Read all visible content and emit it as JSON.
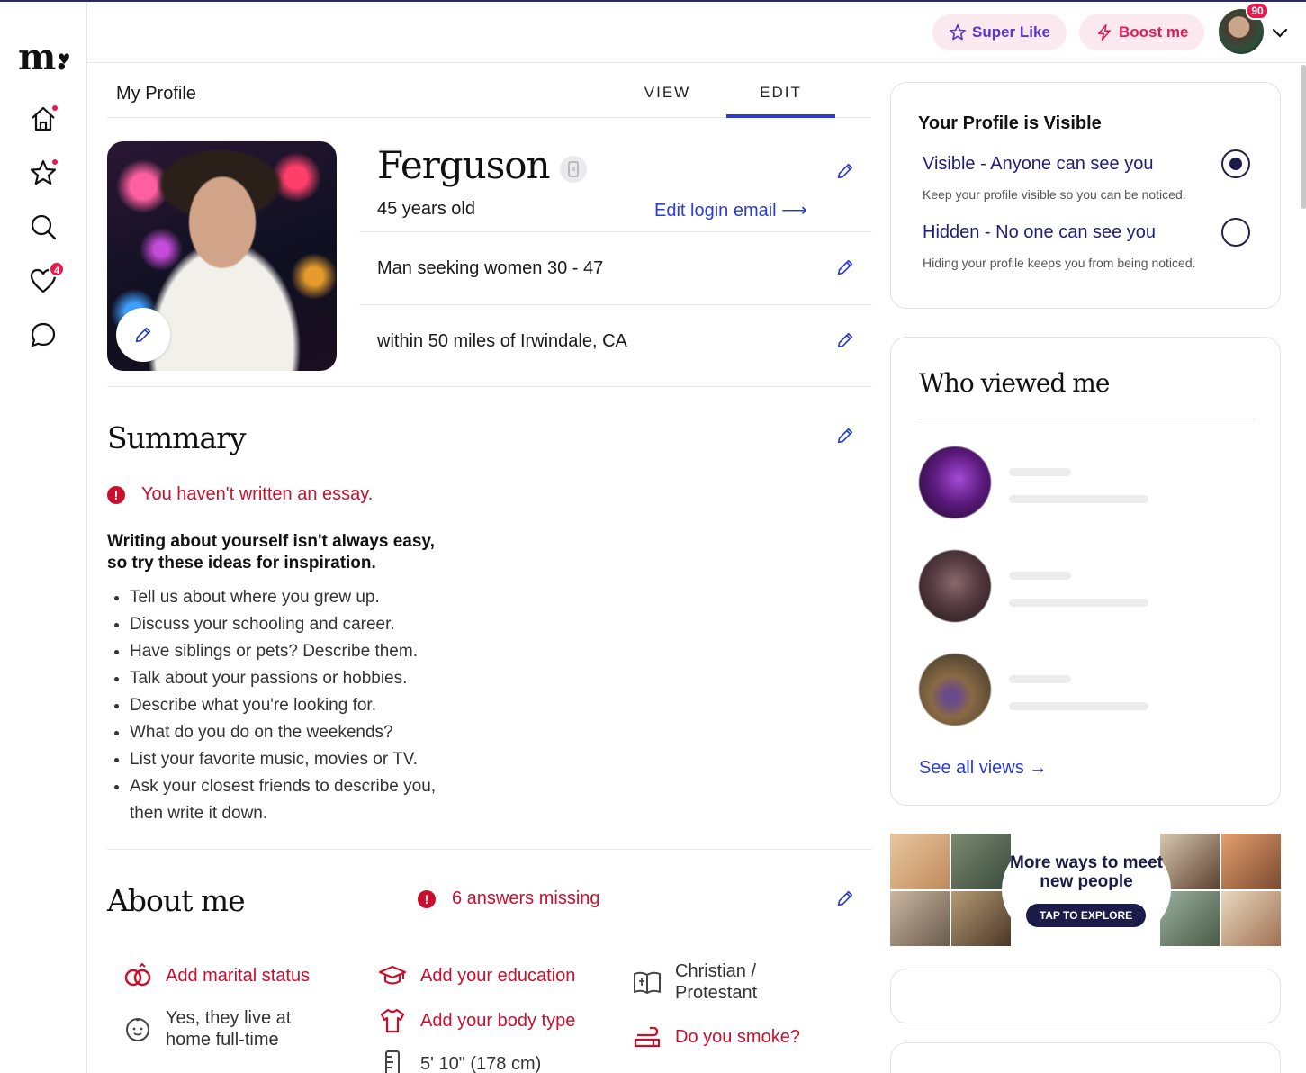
{
  "brand": {
    "logo": "m.",
    "logo_heart": "♥"
  },
  "nav": {
    "items": [
      {
        "name": "home",
        "has_dot": true
      },
      {
        "name": "favorites",
        "has_dot": true
      },
      {
        "name": "search",
        "has_dot": false
      },
      {
        "name": "likes",
        "badge": "4"
      },
      {
        "name": "messages",
        "has_dot": false
      }
    ]
  },
  "header": {
    "super_like_label": "Super Like",
    "boost_label": "Boost me",
    "avatar_badge": "90"
  },
  "profile": {
    "page_title": "My Profile",
    "tab_view": "VIEW",
    "tab_edit": "EDIT",
    "name": "Ferguson",
    "age": "45 years old",
    "edit_email_label": "Edit login email",
    "seeking": "Man seeking women 30 - 47",
    "location": "within 50 miles of Irwindale, CA"
  },
  "summary": {
    "heading": "Summary",
    "warning": "You haven't written an essay.",
    "inspire_line1": "Writing about yourself isn't always easy,",
    "inspire_line2": "so try these ideas for inspiration.",
    "ideas": [
      "Tell us about where you grew up.",
      "Discuss your schooling and career.",
      "Have siblings or pets? Describe them.",
      "Talk about your passions or hobbies.",
      "Describe what you're looking for.",
      "What do you do on the weekends?",
      "List your favorite music, movies or TV.",
      "Ask your closest friends to describe you,",
      "then write it down."
    ]
  },
  "about": {
    "heading": "About me",
    "missing": "6 answers missing",
    "items": {
      "marital": "Add marital status",
      "kids_line1": "Yes, they live at",
      "kids_line2": "home full-time",
      "education": "Add your education",
      "body_type": "Add your body type",
      "height": "5' 10\" (178 cm)",
      "religion_line1": "Christian /",
      "religion_line2": "Protestant",
      "smoke": "Do you smoke?"
    }
  },
  "visibility": {
    "title": "Your Profile is Visible",
    "visible_label": "Visible - Anyone can see you",
    "visible_sub": "Keep your profile visible so you can be noticed.",
    "hidden_label": "Hidden - No one can see you",
    "hidden_sub": "Hiding your profile keeps you from being noticed.",
    "selected": "visible"
  },
  "viewed": {
    "title": "Who viewed me",
    "see_all": "See all views →"
  },
  "promo": {
    "title": "More ways to meet new people",
    "button": "TAP TO EXPLORE"
  },
  "colors": {
    "accent_blue": "#2b3bd6",
    "alert_red": "#c8102e",
    "badge_pink": "#e8194d",
    "navy": "#1c1c4a"
  }
}
